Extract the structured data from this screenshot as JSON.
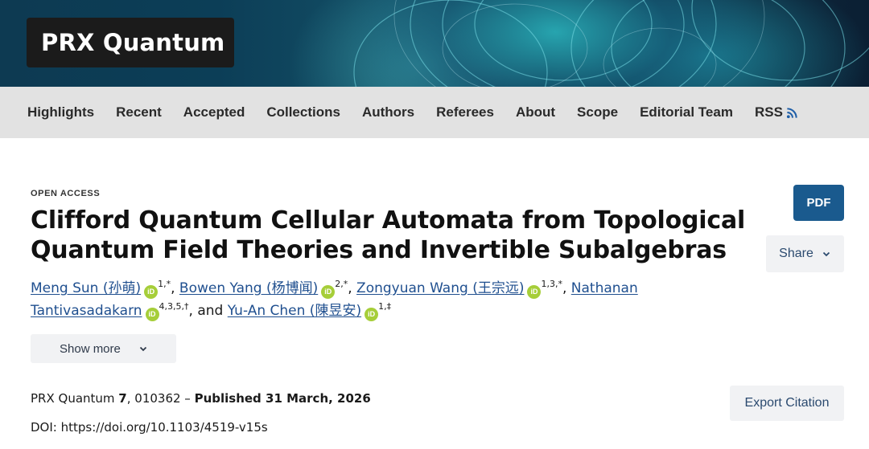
{
  "journal": {
    "name": "PRX Quantum"
  },
  "nav": {
    "items": [
      "Highlights",
      "Recent",
      "Accepted",
      "Collections",
      "Authors",
      "Referees",
      "About",
      "Scope",
      "Editorial Team",
      "RSS"
    ]
  },
  "article": {
    "access": "OPEN ACCESS",
    "title_line1": "Clifford Quantum Cellular Automata from Topological",
    "title_line2": "Quantum Field Theories and Invertible Subalgebras",
    "authors": {
      "a1_name": "Meng Sun (孙萌)",
      "a1_sup": "1,*",
      "a2_name": "Bowen Yang (杨博闻)",
      "a2_sup": "2,*",
      "a3_name": "Zongyuan Wang (王宗远)",
      "a3_sup": "1,3,*",
      "a4_name_part1": "Nathanan",
      "a4_name_part2": "Tantivasadakarn",
      "a4_sup": "4,3,5,†",
      "a5_name": "Yu-An Chen (陳昱安)",
      "a5_sup": "1,‡",
      "sep": ", ",
      "and": ", and "
    },
    "orcid_label": "iD",
    "show_more": "Show more",
    "citation": {
      "journal": "PRX Quantum ",
      "volume": "7",
      "article_no": ", 010362 – ",
      "published": "Published 31 March, 2026"
    },
    "doi": "DOI: https://doi.org/10.1103/4519-v15s"
  },
  "actions": {
    "pdf": "PDF",
    "share": "Share",
    "export_citation": "Export Citation"
  },
  "icons": {
    "rss": "rss-icon",
    "orcid": "orcid-icon",
    "chevron": "chevron-down-icon"
  },
  "colors": {
    "pdf_bg": "#1a5a8e",
    "link": "#1f4f8f",
    "orcid": "#a6ce39",
    "nav_bg": "#e2e2e2",
    "secondary_button_bg": "#f1f2f4"
  }
}
